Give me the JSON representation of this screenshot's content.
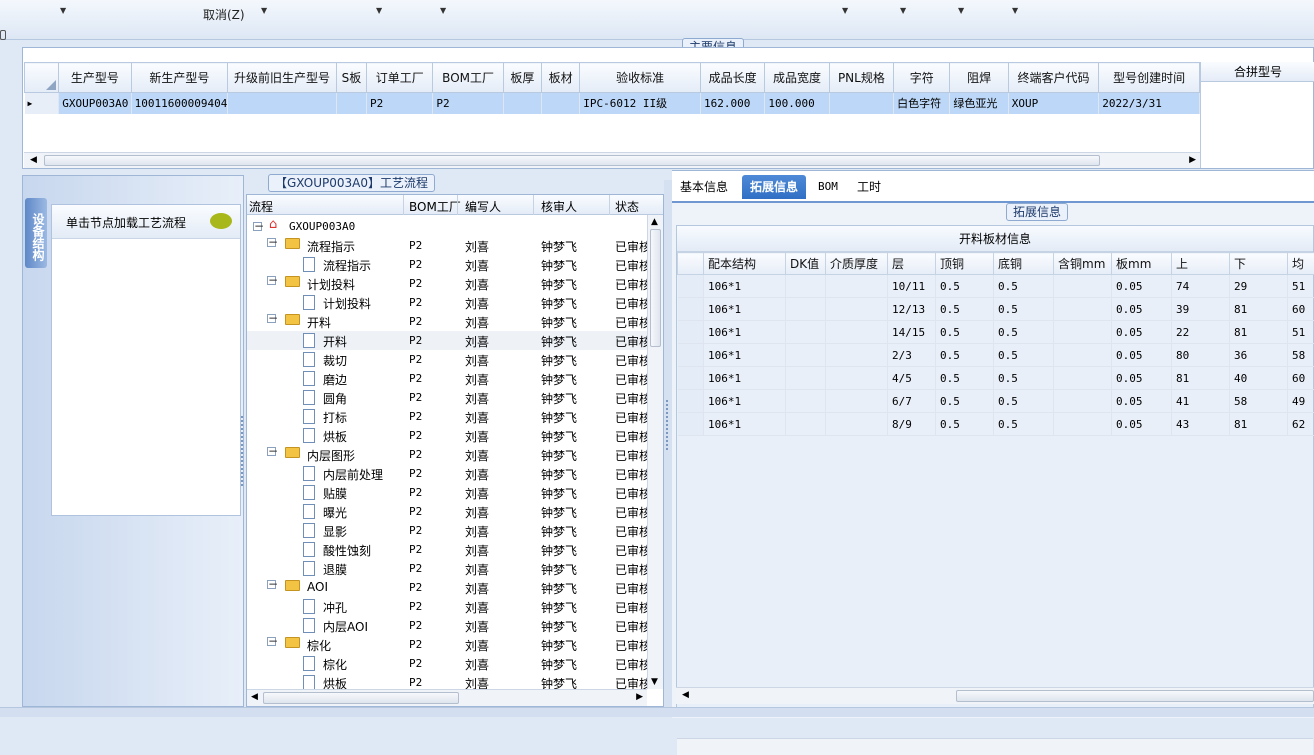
{
  "toolbar": {
    "cancel_label": "取消(Z)"
  },
  "main_info": {
    "legend": "主要信息",
    "columns": [
      "生产型号",
      "新生产型号",
      "升级前旧生产型号",
      "S板",
      "订单工厂",
      "BOM工厂",
      "板厚",
      "板材",
      "验收标准",
      "成品长度",
      "成品宽度",
      "PNL规格",
      "字符",
      "阻焊",
      "终端客户代码",
      "型号创建时间"
    ],
    "row": [
      "GXOUP003A0",
      "10011600009404",
      "",
      "",
      "P2",
      "P2",
      "",
      "",
      "IPC-6012 II级",
      "162.000",
      "100.000",
      "",
      "白色字符",
      "绿色亚光",
      "XOUP",
      "2022/3/31"
    ],
    "merge_header": "合拼型号"
  },
  "left_panel": {
    "vertical_tab": "设备结构",
    "hint": "单击节点加载工艺流程"
  },
  "process": {
    "legend": "【GXOUP003A0】工艺流程",
    "columns": [
      "流程",
      "BOM工厂",
      "编写人",
      "核审人",
      "状态"
    ],
    "root": "GXOUP003A0",
    "rows": [
      {
        "name": "流程指示",
        "level": 1,
        "factory": "P2",
        "writer": "刘喜",
        "reviewer": "钟梦飞",
        "status": "已审核"
      },
      {
        "name": "流程指示",
        "level": 2,
        "factory": "P2",
        "writer": "刘喜",
        "reviewer": "钟梦飞",
        "status": "已审核"
      },
      {
        "name": "计划投料",
        "level": 1,
        "factory": "P2",
        "writer": "刘喜",
        "reviewer": "钟梦飞",
        "status": "已审核"
      },
      {
        "name": "计划投料",
        "level": 2,
        "factory": "P2",
        "writer": "刘喜",
        "reviewer": "钟梦飞",
        "status": "已审核"
      },
      {
        "name": "开料",
        "level": 1,
        "factory": "P2",
        "writer": "刘喜",
        "reviewer": "钟梦飞",
        "status": "已审核"
      },
      {
        "name": "开料",
        "level": 2,
        "factory": "P2",
        "writer": "刘喜",
        "reviewer": "钟梦飞",
        "status": "已审核"
      },
      {
        "name": "裁切",
        "level": 2,
        "factory": "P2",
        "writer": "刘喜",
        "reviewer": "钟梦飞",
        "status": "已审核"
      },
      {
        "name": "磨边",
        "level": 2,
        "factory": "P2",
        "writer": "刘喜",
        "reviewer": "钟梦飞",
        "status": "已审核"
      },
      {
        "name": "圆角",
        "level": 2,
        "factory": "P2",
        "writer": "刘喜",
        "reviewer": "钟梦飞",
        "status": "已审核"
      },
      {
        "name": "打标",
        "level": 2,
        "factory": "P2",
        "writer": "刘喜",
        "reviewer": "钟梦飞",
        "status": "已审核"
      },
      {
        "name": "烘板",
        "level": 2,
        "factory": "P2",
        "writer": "刘喜",
        "reviewer": "钟梦飞",
        "status": "已审核"
      },
      {
        "name": "内层图形",
        "level": 1,
        "factory": "P2",
        "writer": "刘喜",
        "reviewer": "钟梦飞",
        "status": "已审核"
      },
      {
        "name": "内层前处理",
        "level": 2,
        "factory": "P2",
        "writer": "刘喜",
        "reviewer": "钟梦飞",
        "status": "已审核"
      },
      {
        "name": "贴膜",
        "level": 2,
        "factory": "P2",
        "writer": "刘喜",
        "reviewer": "钟梦飞",
        "status": "已审核"
      },
      {
        "name": "曝光",
        "level": 2,
        "factory": "P2",
        "writer": "刘喜",
        "reviewer": "钟梦飞",
        "status": "已审核"
      },
      {
        "name": "显影",
        "level": 2,
        "factory": "P2",
        "writer": "刘喜",
        "reviewer": "钟梦飞",
        "status": "已审核"
      },
      {
        "name": "酸性蚀刻",
        "level": 2,
        "factory": "P2",
        "writer": "刘喜",
        "reviewer": "钟梦飞",
        "status": "已审核"
      },
      {
        "name": "退膜",
        "level": 2,
        "factory": "P2",
        "writer": "刘喜",
        "reviewer": "钟梦飞",
        "status": "已审核"
      },
      {
        "name": "AOI",
        "level": 1,
        "factory": "P2",
        "writer": "刘喜",
        "reviewer": "钟梦飞",
        "status": "已审核"
      },
      {
        "name": "冲孔",
        "level": 2,
        "factory": "P2",
        "writer": "刘喜",
        "reviewer": "钟梦飞",
        "status": "已审核"
      },
      {
        "name": "内层AOI",
        "level": 2,
        "factory": "P2",
        "writer": "刘喜",
        "reviewer": "钟梦飞",
        "status": "已审核"
      },
      {
        "name": "棕化",
        "level": 1,
        "factory": "P2",
        "writer": "刘喜",
        "reviewer": "钟梦飞",
        "status": "已审核"
      },
      {
        "name": "棕化",
        "level": 2,
        "factory": "P2",
        "writer": "刘喜",
        "reviewer": "钟梦飞",
        "status": "已审核"
      },
      {
        "name": "烘板",
        "level": 2,
        "factory": "P2",
        "writer": "刘喜",
        "reviewer": "钟梦飞",
        "status": "已审核"
      }
    ]
  },
  "right": {
    "tabs": [
      "基本信息",
      "拓展信息",
      "BOM",
      "工时"
    ],
    "active_tab": "拓展信息",
    "legend": "拓展信息",
    "table_title": "开料板材信息",
    "columns": [
      "配本结构",
      "DK值",
      "介质厚度",
      "层",
      "顶铜",
      "底铜",
      "含铜mm",
      "板mm",
      "上",
      "下",
      "均"
    ],
    "rows": [
      [
        "106*1",
        "",
        "",
        "10/11",
        "0.5",
        "0.5",
        "",
        "0.05",
        "74",
        "29",
        "51"
      ],
      [
        "106*1",
        "",
        "",
        "12/13",
        "0.5",
        "0.5",
        "",
        "0.05",
        "39",
        "81",
        "60"
      ],
      [
        "106*1",
        "",
        "",
        "14/15",
        "0.5",
        "0.5",
        "",
        "0.05",
        "22",
        "81",
        "51"
      ],
      [
        "106*1",
        "",
        "",
        "2/3",
        "0.5",
        "0.5",
        "",
        "0.05",
        "80",
        "36",
        "58"
      ],
      [
        "106*1",
        "",
        "",
        "4/5",
        "0.5",
        "0.5",
        "",
        "0.05",
        "81",
        "40",
        "60"
      ],
      [
        "106*1",
        "",
        "",
        "6/7",
        "0.5",
        "0.5",
        "",
        "0.05",
        "41",
        "58",
        "49"
      ],
      [
        "106*1",
        "",
        "",
        "8/9",
        "0.5",
        "0.5",
        "",
        "0.05",
        "43",
        "81",
        "62"
      ]
    ]
  },
  "colors": {
    "selection": "#bcd7f7",
    "active_tab": "#2f6fc4",
    "folder": "#f3c444"
  }
}
